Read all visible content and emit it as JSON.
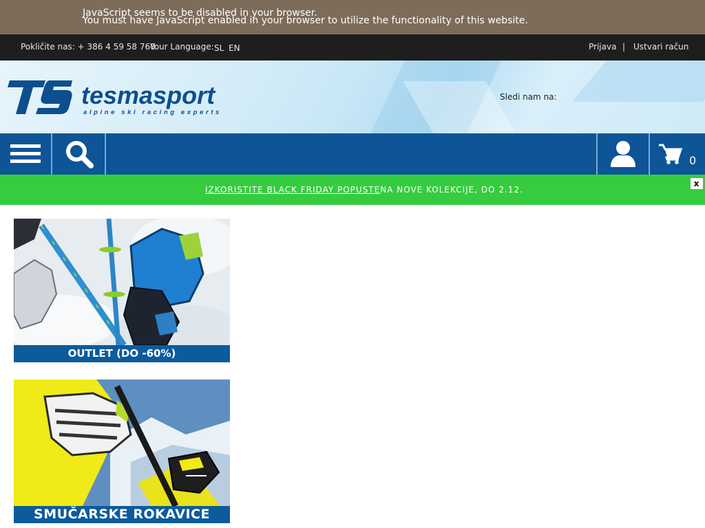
{
  "js_notice": {
    "line1": "JavaScript seems to be disabled in your browser.",
    "line2": "You must have JavaScript enabled in your browser to utilize the functionality of this website."
  },
  "topbar": {
    "phone": "Pokličite nas: + 386 4 59 58 760",
    "language_label": "Your Language:",
    "languages": [
      "SL",
      "EN"
    ],
    "login": "Prijava",
    "separator": "|",
    "register": "Ustvari račun"
  },
  "header": {
    "logo_text": "tesmasport",
    "logo_tagline": "alpine ski racing experts",
    "logo_mark": "TS",
    "follow_label": "Sledi nam na:"
  },
  "navbar": {
    "cart_count": "0"
  },
  "promo": {
    "link_text": "IZKORISTITE BLACK FRIDAY POPUSTE",
    "rest_text": "NA NOVE KOLEKCIJE, DO 2.12.",
    "close_label": "x"
  },
  "banners": [
    {
      "caption": "OUTLET (DO -60%)"
    },
    {
      "caption": "SMUČARSKE ROKAVICE"
    }
  ],
  "colors": {
    "notice_bg": "#7e6c5a",
    "topbar_bg": "#1e1e1e",
    "nav_bg": "#0d5597",
    "promo_bg": "#35cc3f",
    "caption_bg": "#0c5b9c"
  },
  "icons": [
    "hamburger-menu-icon",
    "search-icon",
    "user-icon",
    "cart-icon"
  ]
}
